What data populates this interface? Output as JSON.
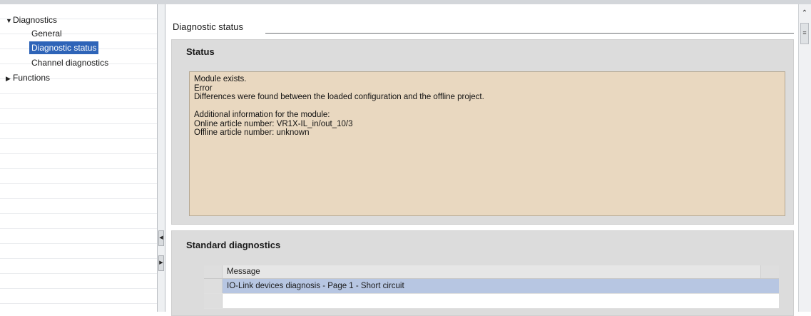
{
  "nav": {
    "items": [
      {
        "label": "Diagnostics",
        "expanded": true
      },
      {
        "label": "General"
      },
      {
        "label": "Diagnostic status",
        "selected": true
      },
      {
        "label": "Channel diagnostics"
      },
      {
        "label": "Functions",
        "expanded": false
      }
    ]
  },
  "section": {
    "title": "Diagnostic status"
  },
  "status_panel": {
    "title": "Status",
    "lines": [
      "Module exists.",
      "Error",
      "Differences were found between the loaded configuration and the offline project.",
      "",
      "Additional information for the module:",
      "Online article number:  VR1X-IL_in/out_10/3",
      "Offline article number:  unknown"
    ]
  },
  "standard_diagnostics": {
    "title": "Standard diagnostics",
    "column_header": "Message",
    "rows": [
      "IO-Link devices diagnosis - Page 1 - Short circuit",
      ""
    ]
  },
  "colors": {
    "selection": "#2e64b8",
    "status_bg": "#e9d8c0",
    "row_selected": "#b7c6e2"
  }
}
